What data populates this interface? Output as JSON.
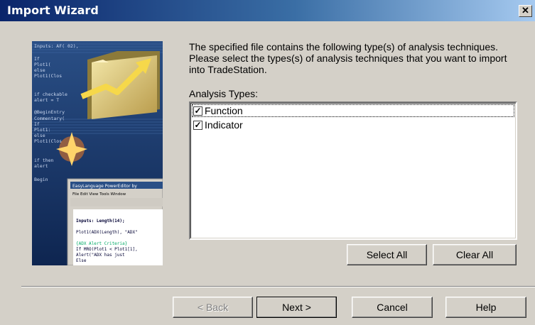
{
  "window": {
    "title": "Import Wizard",
    "close_glyph": "✕"
  },
  "art": {
    "code_lines": [
      "Inputs: AF( 02),",
      "If",
      "Plot1(",
      "else",
      "Plot1(Clos",
      "if checkable",
      "alert = T",
      "@BeginEntry",
      "Commentary(",
      "If",
      "Plot1:",
      "else",
      "Plot1(Clos",
      "if then",
      "alert",
      "Begin"
    ],
    "editor_title": "EasyLanguage PowerEditor by",
    "editor_menu": "File  Edit  View  Tools  Window",
    "editor_code": [
      "Inputs: Length(14);",
      "Plot1(ADX(Length), \"ADX\"",
      "{ADX Alert Criteria}",
      "If MRO(Plot1 < Plot1[1],",
      "Alert(\"ADX has just",
      "Else"
    ]
  },
  "intro_text": "The specified file contains the following type(s) of analysis techniques.  Please select the types(s) of analysis techniques that you want to import into TradeStation.",
  "analysis_types_label": "Analysis Types:",
  "analysis_types": [
    {
      "label": "Function",
      "checked": true
    },
    {
      "label": "Indicator",
      "checked": true
    }
  ],
  "buttons": {
    "select_all": "Select All",
    "clear_all": "Clear All",
    "back": "< Back",
    "next": "Next >",
    "cancel": "Cancel",
    "help": "Help"
  }
}
